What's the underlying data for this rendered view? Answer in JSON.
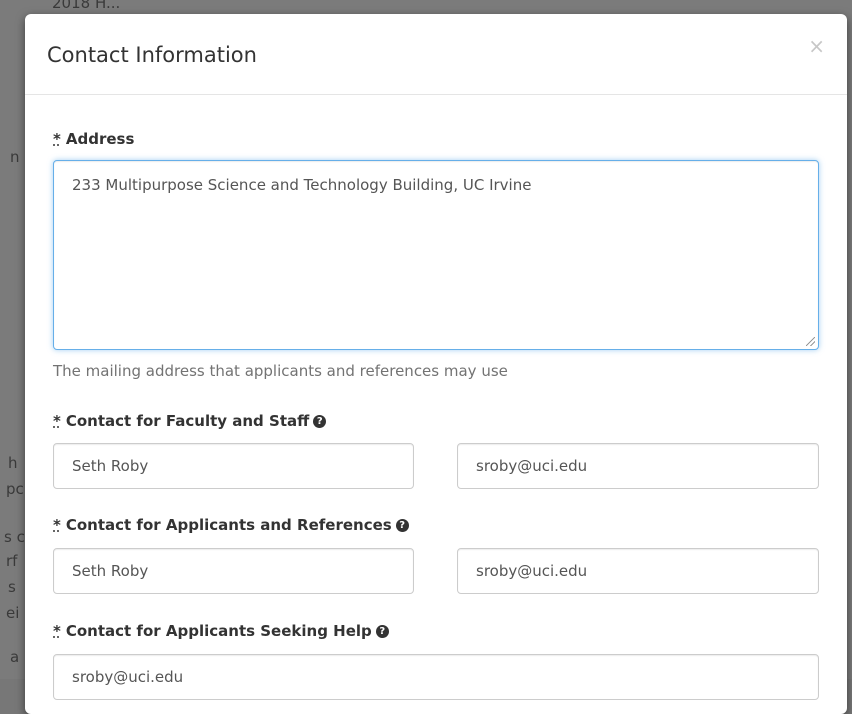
{
  "background": {
    "fragments": [
      "2018 H...",
      "n",
      "h",
      "pc",
      "s c",
      "rf",
      "s",
      "ei",
      "a"
    ]
  },
  "modal": {
    "title": "Contact Information",
    "close_glyph": "×",
    "address": {
      "required_mark": "*",
      "label": "Address",
      "value": "233 Multipurpose Science and Technology Building, UC Irvine",
      "help_text": "The mailing address that applicants and references may use"
    },
    "faculty_contact": {
      "required_mark": "*",
      "label": "Contact for Faculty and Staff",
      "name_value": "Seth Roby",
      "email_value": "sroby@uci.edu"
    },
    "applicant_contact": {
      "required_mark": "*",
      "label": "Contact for Applicants and References",
      "name_value": "Seth Roby",
      "email_value": "sroby@uci.edu"
    },
    "help_contact": {
      "required_mark": "*",
      "label": "Contact for Applicants Seeking Help",
      "email_value": "sroby@uci.edu"
    }
  },
  "icons": {
    "help": "question-circle-icon",
    "close": "close-icon"
  },
  "colors": {
    "focus_border": "#66afe9",
    "input_border": "#cccccc",
    "help_text": "#737373",
    "overlay": "#777777"
  }
}
